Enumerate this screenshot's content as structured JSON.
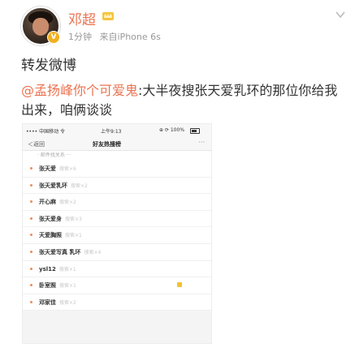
{
  "post": {
    "author": "邓超",
    "author_badge": "crown-icon",
    "time": "1分钟",
    "source": "来自iPhone 6s",
    "repost_title": "转发微博",
    "mention": "@孟扬峰你个可爱鬼",
    "body_rest": ":大半夜搜张天爱乳环的那位你给我出来，咱俩谈谈"
  },
  "screenshot": {
    "status_left": "•••• 中国移动 令",
    "status_time": "上午9:13",
    "status_right": "⊕ ⟳ 100%",
    "back_label": "＜返回",
    "title": "好友热搜榜",
    "more": "···",
    "search_hint": "· 邮件找关系 ···",
    "items": [
      {
        "name": "张天爱",
        "sub": "搜索×6"
      },
      {
        "name": "张天爱乳环",
        "sub": "搜索×2"
      },
      {
        "name": "开心麻",
        "sub": "搜索×2"
      },
      {
        "name": "张天爱身",
        "sub": "搜索×3"
      },
      {
        "name": "天爱胸照",
        "sub": "搜索×1"
      },
      {
        "name": "张天爱写真 乳环",
        "sub": "搜索×4"
      },
      {
        "name": "ysl12",
        "sub": "搜索×1"
      },
      {
        "name": "卧室照",
        "sub": "搜索×1"
      },
      {
        "name": "邓家佳",
        "sub": "搜索×2"
      }
    ]
  },
  "colors": {
    "username": "#eb7350",
    "mention": "#eb7350",
    "muted": "#999999"
  }
}
